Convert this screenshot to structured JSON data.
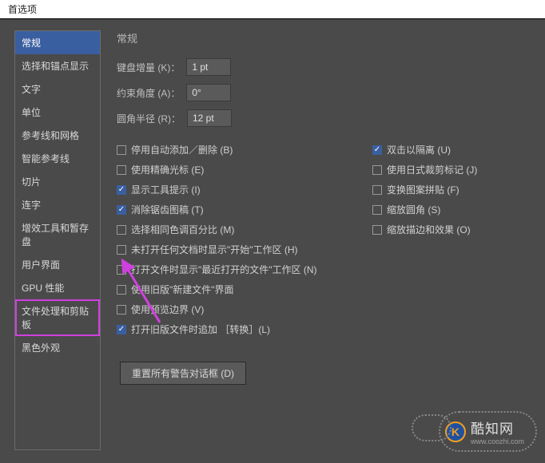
{
  "title": "首选项",
  "sidebar": {
    "items": [
      {
        "label": "常规",
        "active": true
      },
      {
        "label": "选择和锚点显示"
      },
      {
        "label": "文字"
      },
      {
        "label": "单位"
      },
      {
        "label": "参考线和网格"
      },
      {
        "label": "智能参考线"
      },
      {
        "label": "切片"
      },
      {
        "label": "连字"
      },
      {
        "label": "增效工具和暂存盘"
      },
      {
        "label": "用户界面"
      },
      {
        "label": "GPU 性能"
      },
      {
        "label": "文件处理和剪贴板",
        "highlighted": true
      },
      {
        "label": "黑色外观"
      }
    ]
  },
  "main": {
    "section_title": "常规",
    "fields": [
      {
        "label": "键盘增量 (K)：",
        "value": "1 pt"
      },
      {
        "label": "约束角度 (A)：",
        "value": "0°"
      },
      {
        "label": "圆角半径 (R)：",
        "value": "12 pt"
      }
    ],
    "left_checks": [
      {
        "label": "停用自动添加／删除 (B)",
        "checked": false
      },
      {
        "label": "使用精确光标 (E)",
        "checked": false
      },
      {
        "label": "显示工具提示 (I)",
        "checked": true
      },
      {
        "label": "消除锯齿图稿 (T)",
        "checked": true
      },
      {
        "label": "选择相同色调百分比 (M)",
        "checked": false
      },
      {
        "label": "未打开任何文档时显示\"开始\"工作区 (H)",
        "checked": false
      },
      {
        "label": "打开文件时显示\"最近打开的文件\"工作区 (N)",
        "checked": false
      },
      {
        "label": "使用旧版\"新建文件\"界面",
        "checked": false
      },
      {
        "label": "使用预览边界 (V)",
        "checked": false
      },
      {
        "label": "打开旧版文件时追加 ［转换］(L)",
        "checked": true
      }
    ],
    "right_checks": [
      {
        "label": "双击以隔离 (U)",
        "checked": true
      },
      {
        "label": "使用日式裁剪标记 (J)",
        "checked": false
      },
      {
        "label": "变换图案拼贴 (F)",
        "checked": false
      },
      {
        "label": "缩放圆角 (S)",
        "checked": false
      },
      {
        "label": "缩放描边和效果 (O)",
        "checked": false
      }
    ],
    "reset_button": "重置所有警告对话框 (D)"
  },
  "watermark": {
    "logo": "K",
    "text": "酷知网",
    "sub": "www.coozhi.com"
  }
}
